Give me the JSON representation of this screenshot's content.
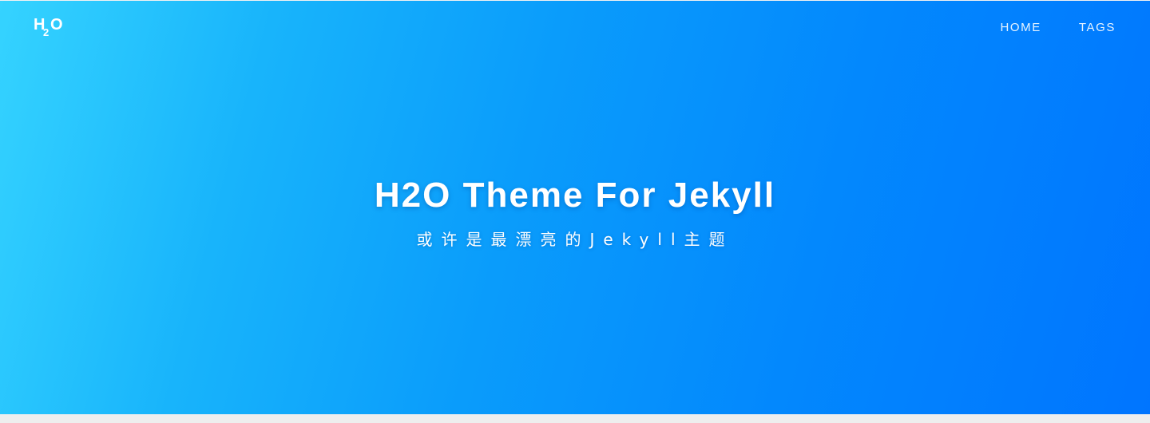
{
  "logo": {
    "h": "H",
    "two": "2",
    "o": "O"
  },
  "nav": {
    "items": [
      {
        "label": "HOME"
      },
      {
        "label": "TAGS"
      }
    ]
  },
  "hero": {
    "title": "H2O Theme For Jekyll",
    "subtitle": "或许是最漂亮的Jekyll主题"
  },
  "colors": {
    "gradient_start": "#35d3ff",
    "gradient_end": "#0075ff",
    "text": "#ffffff"
  }
}
